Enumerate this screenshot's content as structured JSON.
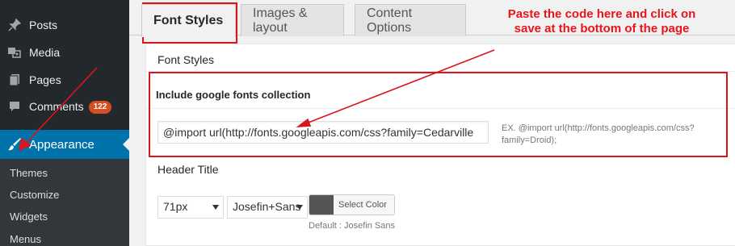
{
  "sidebar": {
    "items": [
      {
        "label": "Posts",
        "icon": "pin-icon"
      },
      {
        "label": "Media",
        "icon": "media-icon"
      },
      {
        "label": "Pages",
        "icon": "pages-icon"
      },
      {
        "label": "Comments",
        "icon": "comments-icon",
        "badge": "122"
      },
      {
        "label": "Appearance",
        "icon": "brush-icon",
        "active": true
      }
    ],
    "submenu": [
      "Themes",
      "Customize",
      "Widgets",
      "Menus"
    ]
  },
  "tabs": [
    {
      "label": "Font Styles",
      "active": true
    },
    {
      "label": "Images & layout"
    },
    {
      "label": "Content Options"
    }
  ],
  "panel": {
    "section_title": "Font Styles",
    "google_fonts_label": "Include google fonts collection",
    "import_value": "@import url(http://fonts.googleapis.com/css?family=Cedarville",
    "import_hint": "EX. @import url(http://fonts.googleapis.com/css?family=Droid);",
    "header_title_label": "Header Title",
    "size_value": "71px",
    "font_value": "Josefin+Sans",
    "color_button_label": "Select Color",
    "color_value": "#555555",
    "font_default": "Default : Josefin Sans"
  },
  "annotation": {
    "instruction": "Paste the code here and click on save at the bottom of the page"
  },
  "colors": {
    "sidebar_bg": "#23282d",
    "active_menu": "#0073aa",
    "badge": "#d54e21",
    "annotation_red": "#e8151b"
  }
}
